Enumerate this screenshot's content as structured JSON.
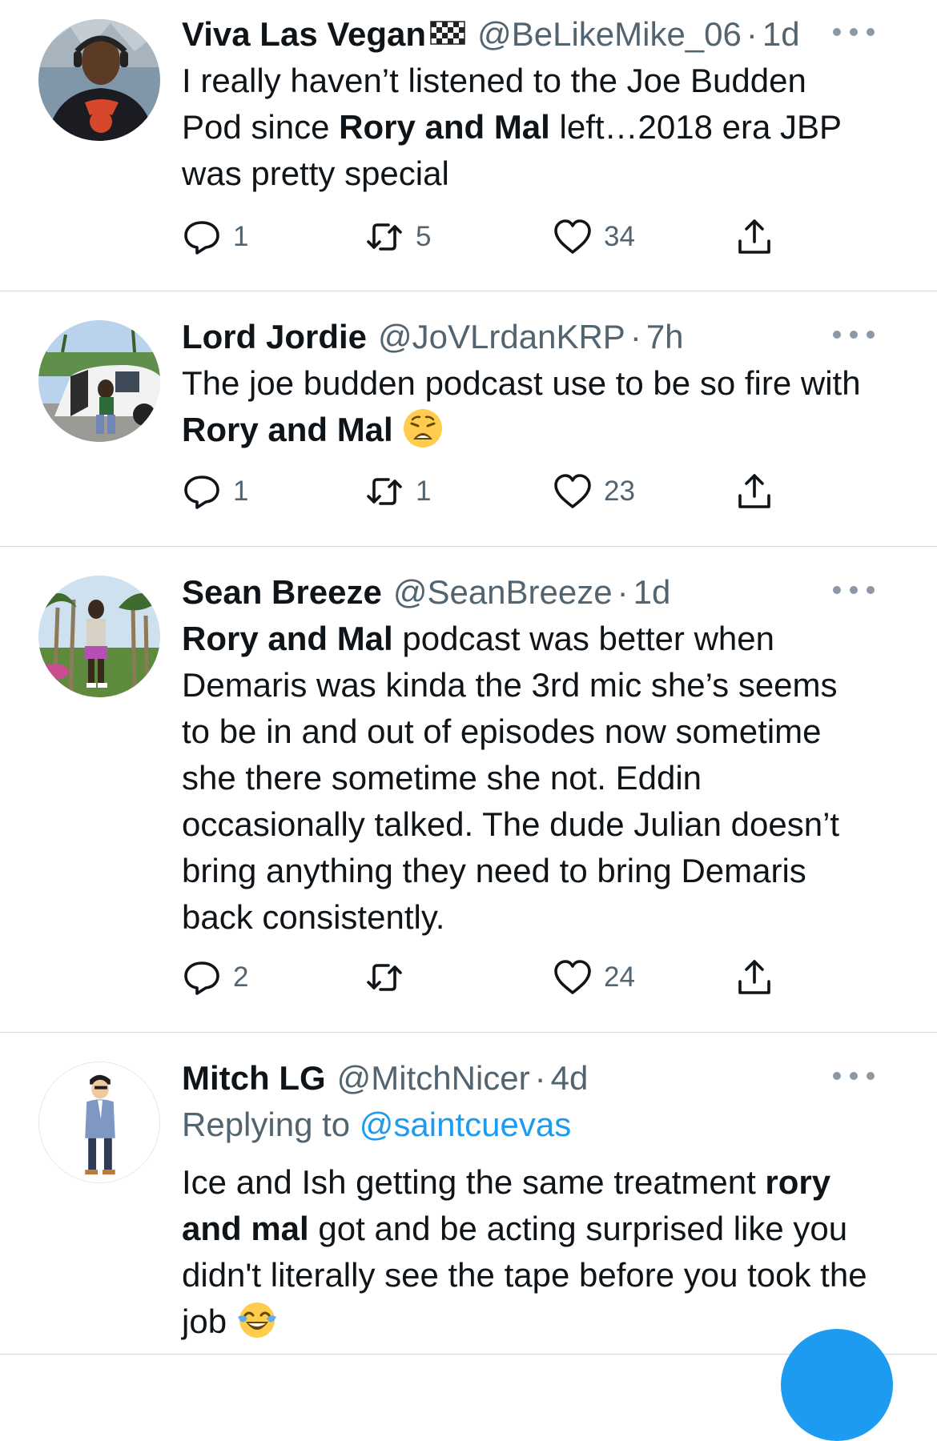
{
  "tweets": [
    {
      "display_name": "Viva Las Vegan",
      "display_name_emoji": "chequered-flag-icon",
      "handle": "@BeLikeMike_06",
      "separator": "·",
      "time": "1d",
      "body_1": "I really haven’t listened to the Joe Budden Pod since ",
      "body_bold": "Rory and Mal",
      "body_2": " left…2018 era JBP was pretty special",
      "replies": "1",
      "retweets": "5",
      "likes": "34"
    },
    {
      "display_name": "Lord Jordie",
      "handle": "@JoVLrdanKRP",
      "separator": "·",
      "time": "7h",
      "body_1": "The joe budden podcast use to be so fire with ",
      "body_bold": "Rory and Mal",
      "body_2": " ",
      "body_emoji": "weary-face-emoji",
      "replies": "1",
      "retweets": "1",
      "likes": "23"
    },
    {
      "display_name": "Sean Breeze",
      "handle": "@SeanBreeze",
      "separator": "·",
      "time": "1d",
      "body_bold": "Rory and Mal",
      "body_2": " podcast was better when Demaris was kinda the 3rd mic she’s seems to be in and out of episodes now sometime she there sometime she not. Eddin occasionally talked. The dude Julian doesn’t bring anything they need to bring Demaris back consistently.",
      "replies": "2",
      "retweets": "",
      "likes": "24"
    },
    {
      "display_name": "Mitch LG",
      "handle": "@MitchNicer",
      "separator": "·",
      "time": "4d",
      "replying_to_label": "Replying to ",
      "replying_to_handle": "@saintcuevas",
      "body_1": "Ice and Ish getting the same treatment ",
      "body_bold": "rory and mal",
      "body_2": " got and be acting surprised like you didn't literally see the tape before you took the job ",
      "body_emoji": "face-with-tears-of-joy-emoji"
    }
  ],
  "colors": {
    "text_primary": "#0f1419",
    "text_secondary": "#536471",
    "accent": "#1d9bf0",
    "divider": "#cfd9de"
  }
}
